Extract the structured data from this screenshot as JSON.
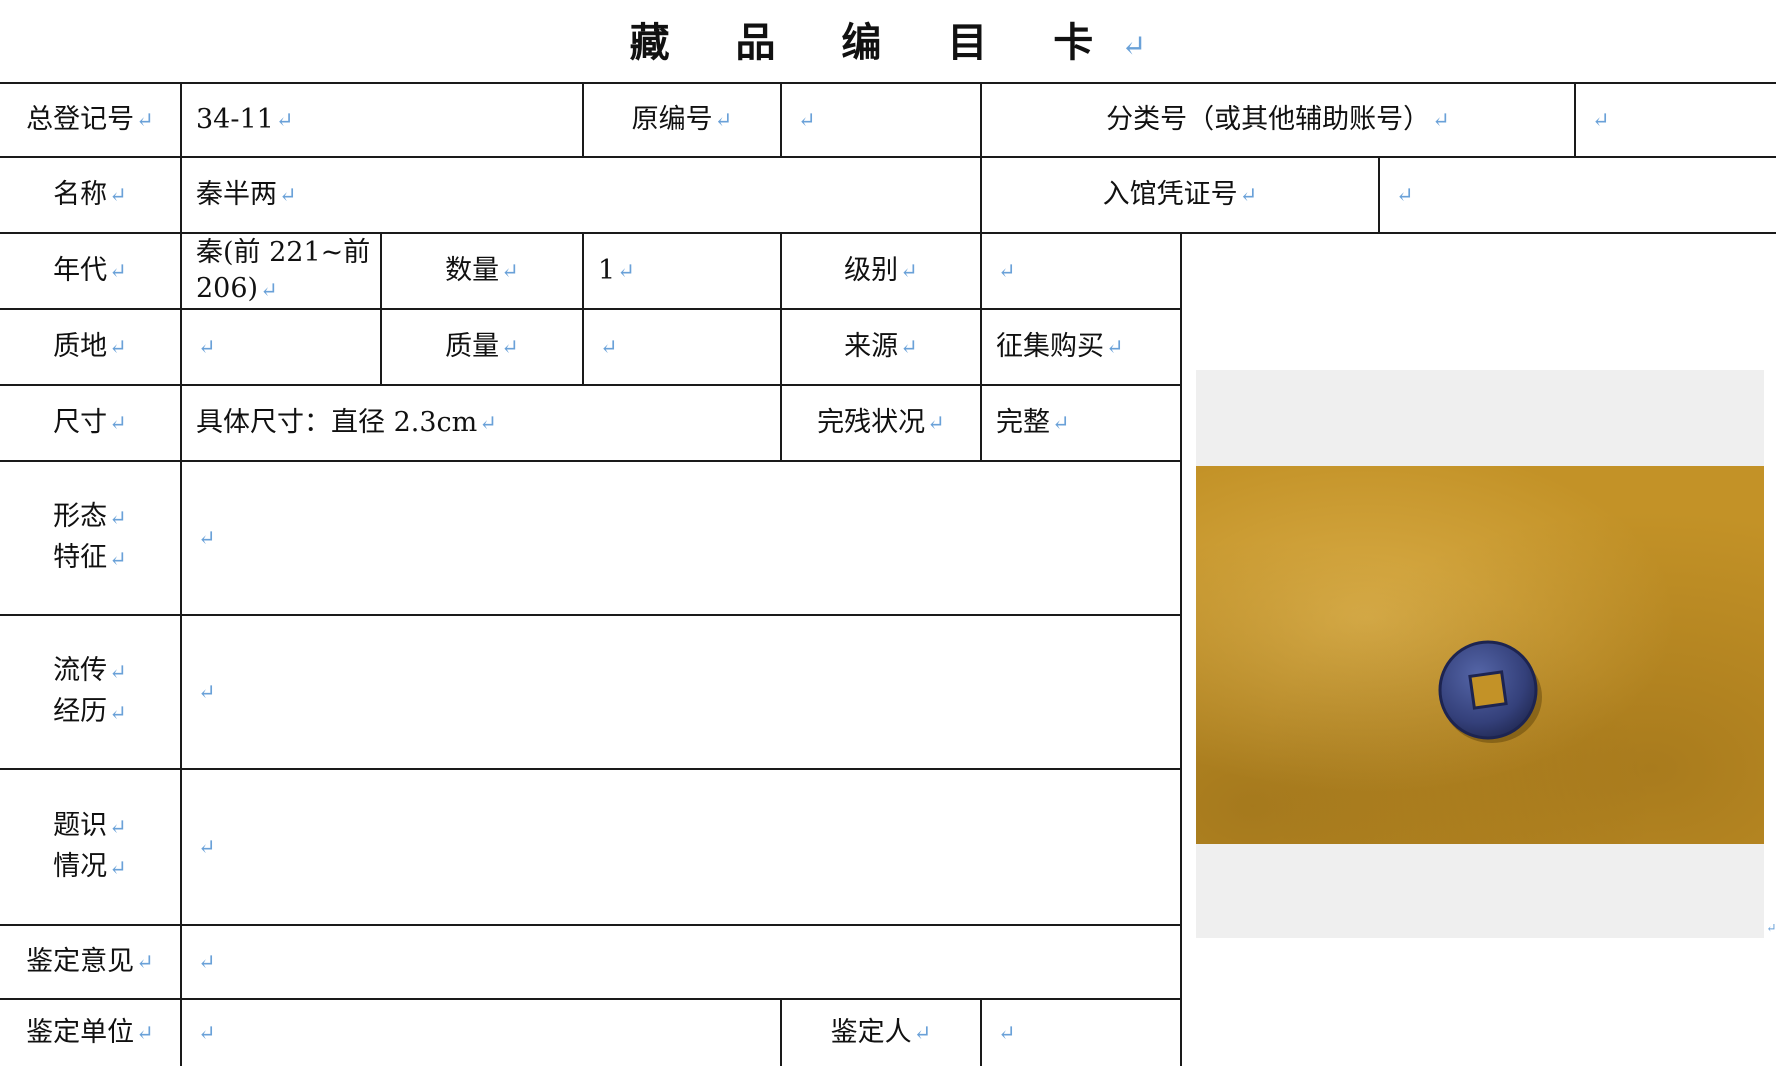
{
  "title": "藏 品 编 目 卡",
  "return_mark": "↵",
  "labels": {
    "reg_no": "总登记号",
    "orig_no": "原编号",
    "class_no": "分类号（或其他辅助账号）",
    "name": "名称",
    "entry_no": "入馆凭证号",
    "era": "年代",
    "quantity": "数量",
    "grade": "级别",
    "material": "质地",
    "weight": "质量",
    "source": "来源",
    "size": "尺寸",
    "condition": "完残状况",
    "form_1": "形态",
    "form_2": "特征",
    "history_1": "流传",
    "history_2": "经历",
    "inscription_1": "题识",
    "inscription_2": "情况",
    "opinion": "鉴定意见",
    "unit": "鉴定单位",
    "appraiser": "鉴定人"
  },
  "values": {
    "reg_no": "34-11",
    "orig_no": "",
    "class_no": "",
    "name": "秦半两",
    "entry_no": "",
    "era_1": "秦(前 221~前",
    "era_2": "206)",
    "quantity": "1",
    "grade": "",
    "material": "",
    "weight": "",
    "source": "征集购买",
    "size": "具体尺寸：直径 2.3cm",
    "condition": "完整",
    "form": "",
    "history": "",
    "inscription": "",
    "opinion": "",
    "unit": "",
    "appraiser": ""
  },
  "colors": {
    "return_mark": "#6aa1d8",
    "border": "#1a1a1a",
    "photo_background": "#c39227",
    "coin": "#3b4a86",
    "photo_frame": "#efefef"
  }
}
